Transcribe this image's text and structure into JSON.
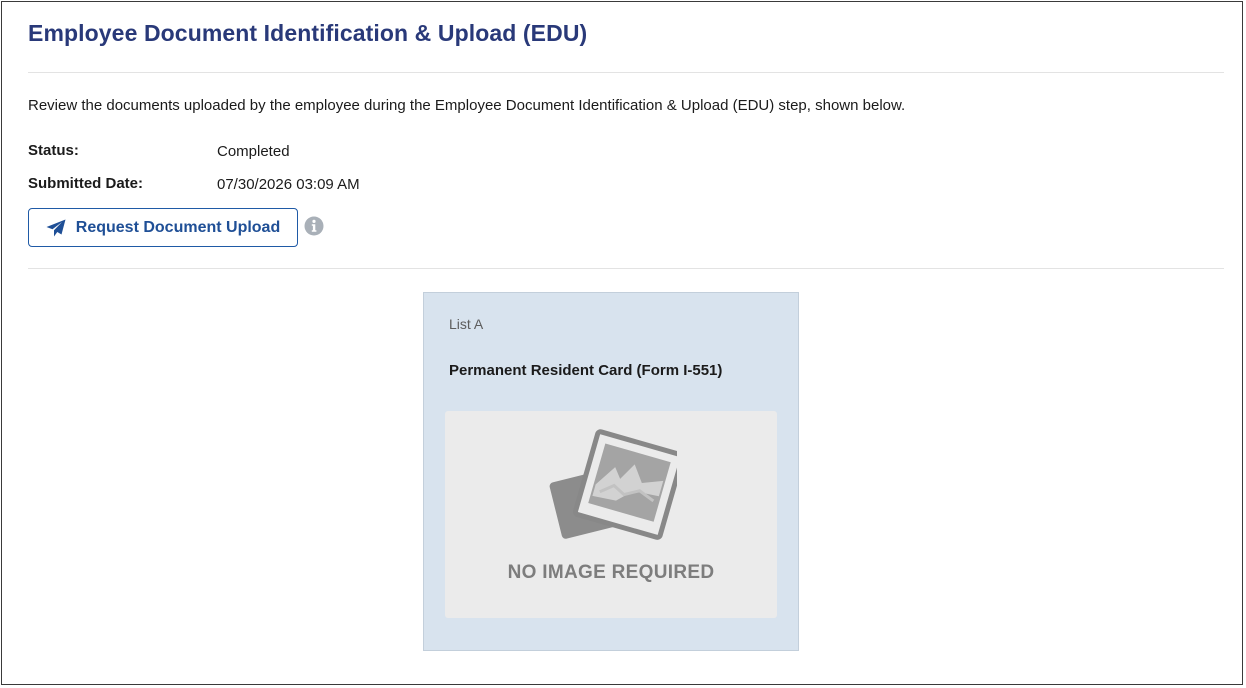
{
  "header": {
    "title": "Employee Document Identification & Upload (EDU)"
  },
  "intro": "Review the documents uploaded by the employee during the Employee Document Identification & Upload (EDU) step, shown below.",
  "details": {
    "status_label": "Status:",
    "status_value": "Completed",
    "submitted_label": "Submitted Date:",
    "submitted_value": "07/30/2026 03:09 AM"
  },
  "actions": {
    "request_upload_label": "Request Document Upload",
    "request_upload_icon": "paper-plane-icon",
    "info_icon": "info-circle-icon"
  },
  "document_card": {
    "list_label": "List A",
    "document_name": "Permanent Resident Card (Form I-551)",
    "image_placeholder_icon": "photo-placeholder-icon",
    "image_placeholder_text": "NO IMAGE REQUIRED"
  },
  "colors": {
    "title": "#293979",
    "button_border": "#1f5aa6",
    "button_text": "#1f4f96",
    "card_background": "#d8e3ee",
    "placeholder_background": "#ebebeb",
    "placeholder_text": "#7d7d7d"
  }
}
